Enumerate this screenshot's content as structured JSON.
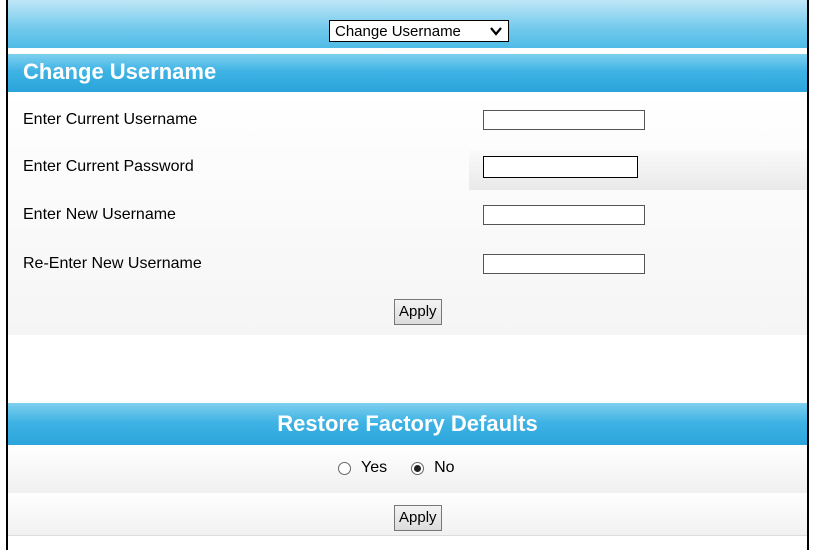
{
  "selector": {
    "value": "Change Username"
  },
  "change_username": {
    "title": "Change Username",
    "fields": [
      {
        "label": "Enter Current Username",
        "value": ""
      },
      {
        "label": "Enter Current Password",
        "value": ""
      },
      {
        "label": "Enter New Username",
        "value": ""
      },
      {
        "label": "Re-Enter New Username",
        "value": ""
      }
    ],
    "apply_label": "Apply"
  },
  "restore_defaults": {
    "title": "Restore Factory Defaults",
    "options": [
      {
        "label": "Yes",
        "selected": false
      },
      {
        "label": "No",
        "selected": true
      }
    ],
    "apply_label": "Apply"
  },
  "colors": {
    "header_blue": "#2aa4db",
    "header_light": "#7fd0ef",
    "border": "#000000"
  }
}
